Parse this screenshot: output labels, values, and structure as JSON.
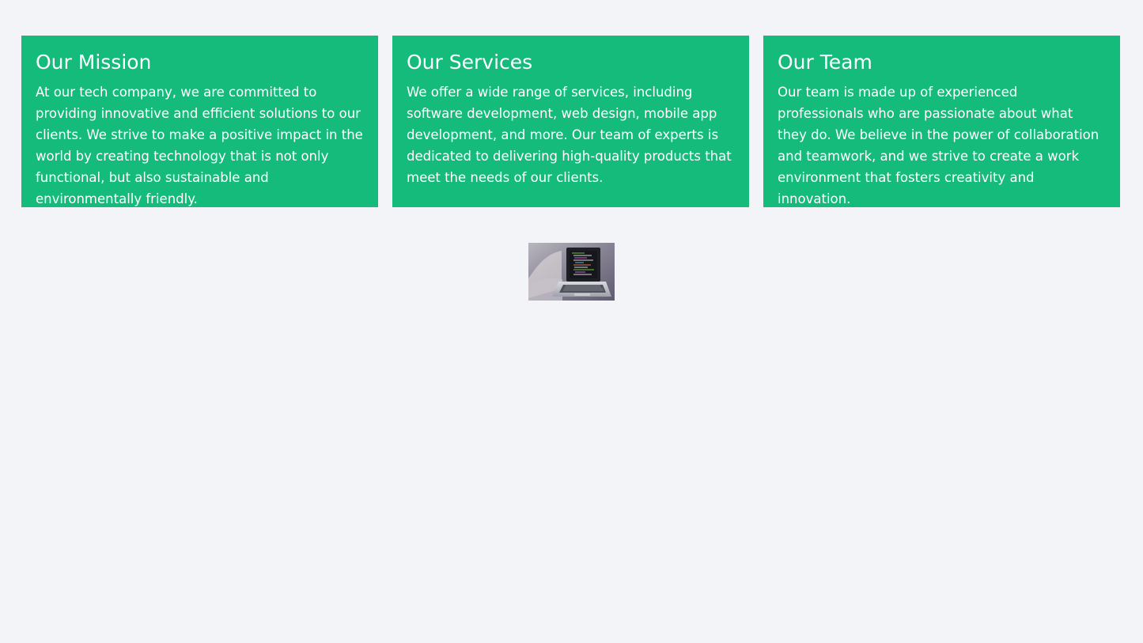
{
  "colors": {
    "background": "#f3f4f7",
    "card": "#14bb7a",
    "card_text": "#ffffff"
  },
  "cards": [
    {
      "title": "Our Mission",
      "text": "At our tech company, we are committed to providing innovative and efficient solutions to our clients. We strive to make a positive impact in the world by creating technology that is not only functional, but also sustainable and environmentally friendly."
    },
    {
      "title": "Our Services",
      "text": "We offer a wide range of services, including software development, web design, mobile app development, and more. Our team of experts is dedicated to delivering high-quality products that meet the needs of our clients."
    },
    {
      "title": "Our Team",
      "text": "Our team is made up of experienced professionals who are passionate about what they do. We believe in the power of collaboration and teamwork, and we strive to create a work environment that fosters creativity and innovation."
    }
  ],
  "image": {
    "icon": "laptop-photo-icon"
  }
}
